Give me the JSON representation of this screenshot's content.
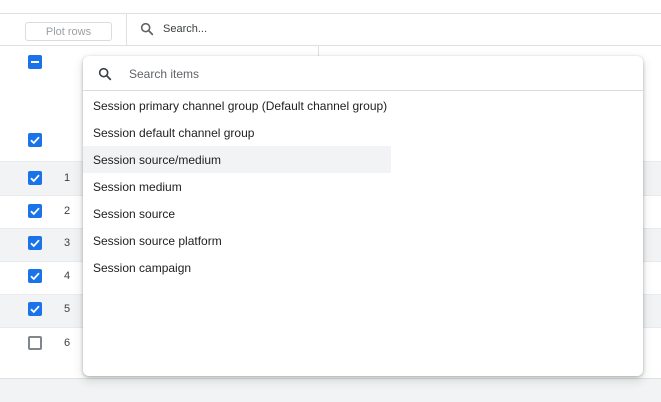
{
  "toolbar": {
    "plot_rows_label": "Plot rows",
    "search_placeholder": "Search..."
  },
  "table": {
    "rows": [
      {
        "num": "1",
        "checked": true
      },
      {
        "num": "2",
        "checked": true
      },
      {
        "num": "3",
        "checked": true
      },
      {
        "num": "4",
        "checked": true
      },
      {
        "num": "5",
        "checked": true
      },
      {
        "num": "6",
        "checked": false
      }
    ]
  },
  "dropdown": {
    "search_placeholder": "Search items",
    "items": [
      {
        "label": "Session primary channel group (Default channel group)"
      },
      {
        "label": "Session default channel group"
      },
      {
        "label": "Session source/medium"
      },
      {
        "label": "Session medium"
      },
      {
        "label": "Session source"
      },
      {
        "label": "Session source platform"
      },
      {
        "label": "Session campaign"
      }
    ]
  },
  "colors": {
    "accent": "#1a73e8",
    "hover": "#f1f3f4"
  }
}
